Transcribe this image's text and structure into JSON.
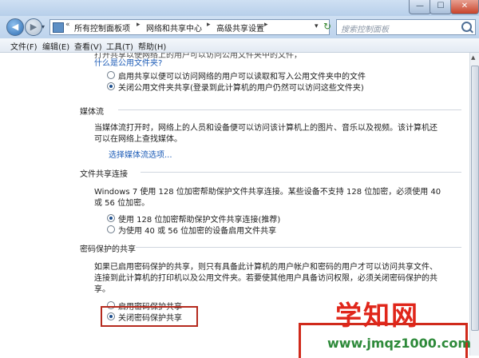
{
  "window": {
    "min_label": "—",
    "max_label": "☐",
    "close_label": "✕"
  },
  "nav": {
    "back_label": "◀",
    "forward_label": "▶",
    "dropdown_label": "▾",
    "overflow_label": "«",
    "breadcrumbs": [
      "所有控制面板项",
      "网络和共享中心",
      "高级共享设置"
    ],
    "address_dropdown_label": "▾",
    "refresh_label": "↻",
    "search_placeholder": "搜索控制面板"
  },
  "menu": [
    "文件(F)",
    "编辑(E)",
    "查看(V)",
    "工具(T)",
    "帮助(H)"
  ],
  "public_folder": {
    "intro_line1": "打开共享以使网络上的用户可以访问公用文件夹中的文件，",
    "intro_link": "什么是公用文件夹?",
    "options": [
      {
        "label": "启用共享以便可以访问网络的用户可以读取和写入公用文件夹中的文件",
        "selected": false
      },
      {
        "label": "关闭公用文件夹共享(登录到此计算机的用户仍然可以访问这些文件夹)",
        "selected": true
      }
    ]
  },
  "media_streaming": {
    "title": "媒体流",
    "desc_line1": "当媒体流打开时，网络上的人员和设备便可以访问该计算机上的图片、音乐以及视频。该计算机还",
    "desc_line2": "可以在网络上查找媒体。",
    "link": "选择媒体流选项..."
  },
  "file_sharing": {
    "title": "文件共享连接",
    "desc_line1": "Windows 7 使用 128 位加密帮助保护文件共享连接。某些设备不支持 128 位加密，必须使用 40",
    "desc_line2": "或 56 位加密。",
    "options": [
      {
        "label": "使用 128 位加密帮助保护文件共享连接(推荐)",
        "selected": true
      },
      {
        "label": "为使用 40 或 56 位加密的设备启用文件共享",
        "selected": false
      }
    ]
  },
  "password_sharing": {
    "title": "密码保护的共享",
    "desc_line1": "如果已启用密码保护的共享，则只有具备此计算机的用户帐户和密码的用户才可以访问共享文件、",
    "desc_line2": "连接到此计算机的打印机以及公用文件夹。若要使其他用户具备访问权限，必须关闭密码保护的共",
    "desc_line3": "享。",
    "options": [
      {
        "label": "启用密码保护共享",
        "selected": false
      },
      {
        "label": "关闭密码保护共享",
        "selected": true
      }
    ]
  },
  "watermark": {
    "logo_text": "学知网",
    "url": "www.jmqz1000.com"
  },
  "colors": {
    "accent": "#1a5ab6",
    "highlight": "#b52a1e",
    "logo_red": "#e0261a",
    "logo_green": "#2e8a3a"
  }
}
